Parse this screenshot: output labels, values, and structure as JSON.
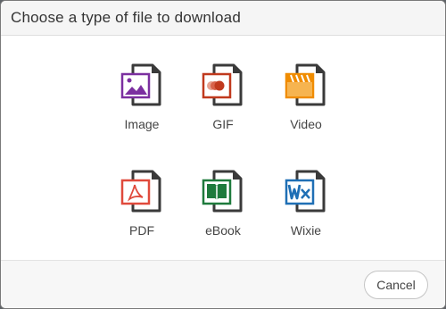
{
  "dialog": {
    "title": "Choose a type of file to download",
    "cancel_label": "Cancel"
  },
  "options": [
    {
      "label": "Image",
      "icon": "image-file-icon",
      "color": "#7b2fa0"
    },
    {
      "label": "GIF",
      "icon": "gif-file-icon",
      "color": "#c0391d"
    },
    {
      "label": "Video",
      "icon": "video-file-icon",
      "color": "#f08c00"
    },
    {
      "label": "PDF",
      "icon": "pdf-file-icon",
      "color": "#e04a3c"
    },
    {
      "label": "eBook",
      "icon": "ebook-file-icon",
      "color": "#1e7a3c"
    },
    {
      "label": "Wixie",
      "icon": "wixie-file-icon",
      "color": "#1f6fb5"
    }
  ]
}
